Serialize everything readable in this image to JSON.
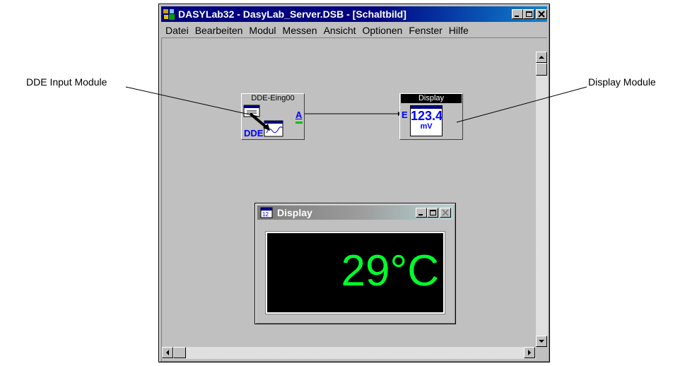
{
  "window": {
    "title": "DASYLab32 - DasyLab_Server.DSB - [Schaltbild]"
  },
  "menu": [
    "Datei",
    "Bearbeiten",
    "Modul",
    "Messen",
    "Ansicht",
    "Optionen",
    "Fenster",
    "Hilfe"
  ],
  "modules": {
    "dde_input": {
      "title": "DDE-Eing00",
      "port_out": "A",
      "badge": "DDE"
    },
    "display": {
      "title": "Display",
      "port_in": "E",
      "value": "123.4",
      "unit": "mV"
    }
  },
  "display_window": {
    "title": "Display",
    "reading": "29°C",
    "reading_color": "#00ff2a"
  },
  "callouts": {
    "left": "DDE Input Module",
    "right": "Display Module"
  },
  "colors": {
    "titlebar_active": "#000080",
    "titlebar_inactive": "#7b7b7b",
    "workspace": "#c0c0c0"
  }
}
